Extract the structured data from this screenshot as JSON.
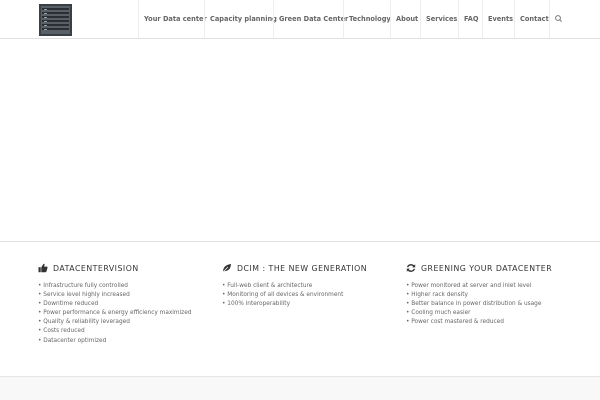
{
  "header": {
    "logo_icon": "server-rack-icon",
    "nav": [
      {
        "label": "Your Data center"
      },
      {
        "label": "Capacity planning"
      },
      {
        "label": "Green Data Center"
      },
      {
        "label": "Technology"
      },
      {
        "label": "About"
      },
      {
        "label": "Services"
      },
      {
        "label": "FAQ"
      },
      {
        "label": "Events"
      },
      {
        "label": "Contact"
      }
    ],
    "search_icon": "search-icon"
  },
  "features": [
    {
      "icon": "thumbs-up-icon",
      "title": "DATACENTERVISION",
      "items": [
        "Infrastructure fully controlled",
        "Service level highly increased",
        "Downtime reduced",
        "Power performance & energy efficiency maximized",
        "Quality & reliability leveraged",
        "Costs reduced",
        "Datacenter optimized"
      ]
    },
    {
      "icon": "leaf-icon",
      "title": "DCIM : THE NEW GENERATION",
      "items": [
        "Full-web client & architecture",
        "Monitoring of all devices & environment",
        "100% interoperability"
      ]
    },
    {
      "icon": "refresh-icon",
      "title": "GREENING YOUR DATACENTER",
      "items": [
        "Power monitored at server and inlet level",
        "Higher rack density",
        "Better balance in power distribution & usage",
        "Cooling much easier",
        "Power cost mastered & reduced"
      ]
    }
  ],
  "colors": {
    "text": "#333333",
    "muted": "#666666",
    "border": "#e1e1e1"
  }
}
